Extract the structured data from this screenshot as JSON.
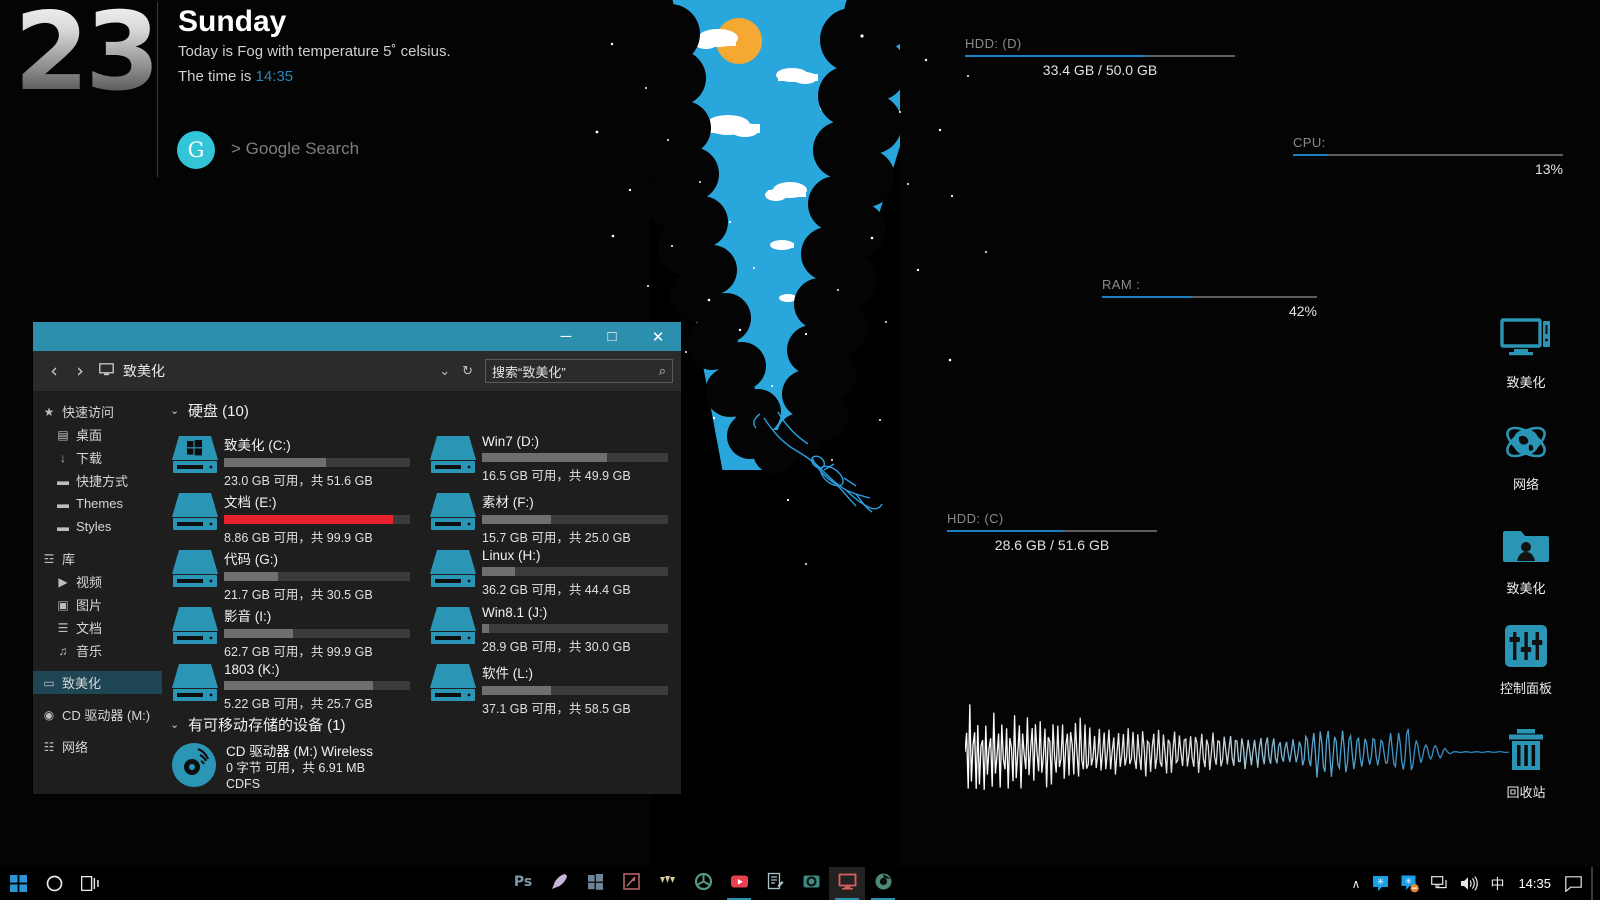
{
  "date_widget": {
    "day_number": "23",
    "weekday": "Sunday",
    "weather_line": "Today is Fog with temperature 5˚ celsius.",
    "time_prefix": "The time is ",
    "time_value": "14:35",
    "google_badge": "G",
    "google_label": "> Google Search",
    "accent_time": "#2e82b5",
    "google_circle": "#32c5d8"
  },
  "monitors": [
    {
      "name": "hdd-d",
      "label": "HDD: (D)",
      "value": "33.4 GB / 50.0 GB",
      "percent": 67
    },
    {
      "name": "cpu",
      "label": "CPU:",
      "value": "13%",
      "percent": 13
    },
    {
      "name": "ram",
      "label": "RAM :",
      "value": "42%",
      "percent": 42
    },
    {
      "name": "hdd-c",
      "label": "HDD: (C)",
      "value": "28.6 GB / 51.6 GB",
      "percent": 55
    }
  ],
  "visualizer": {
    "label": "audio-spectrum",
    "color_start": "#ffffff",
    "color_end": "#1f7fb8"
  },
  "desktop_icons": [
    {
      "name": "this-pc",
      "label": "致美化",
      "icon": "monitor-icon"
    },
    {
      "name": "network",
      "label": "网络",
      "icon": "globe-network-icon"
    },
    {
      "name": "user-folder",
      "label": "致美化",
      "icon": "user-folder-icon"
    },
    {
      "name": "control-panel",
      "label": "控制面板",
      "icon": "sliders-icon"
    },
    {
      "name": "recycle-bin",
      "label": "回收站",
      "icon": "trash-icon"
    }
  ],
  "explorer": {
    "title_bar": {
      "minimize": "─",
      "maximize": "□",
      "close": "✕"
    },
    "nav": {
      "back": "‹",
      "forward": "›",
      "crumb_icon": "computer-icon",
      "crumb_text": "致美化",
      "chevron": "⌄",
      "refresh": "↻",
      "search_placeholder": "搜索“致美化”",
      "search_value": "搜索“致美化”",
      "search_icon": "⌕"
    },
    "sidebar": [
      {
        "label": "快速访问",
        "icon": "pin-star-icon",
        "level": 0,
        "selected": false
      },
      {
        "label": "桌面",
        "icon": "folder-desktop-icon",
        "level": 1,
        "selected": false
      },
      {
        "label": "下载",
        "icon": "download-icon",
        "level": 1,
        "selected": false
      },
      {
        "label": "快捷方式",
        "icon": "folder-icon",
        "level": 1,
        "selected": false
      },
      {
        "label": "Themes",
        "icon": "folder-icon",
        "level": 1,
        "selected": false
      },
      {
        "label": "Styles",
        "icon": "folder-icon",
        "level": 1,
        "selected": false
      },
      {
        "label": "库",
        "icon": "library-icon",
        "level": 0,
        "selected": false
      },
      {
        "label": "视频",
        "icon": "video-icon",
        "level": 1,
        "selected": false
      },
      {
        "label": "图片",
        "icon": "picture-icon",
        "level": 1,
        "selected": false
      },
      {
        "label": "文档",
        "icon": "document-icon",
        "level": 1,
        "selected": false
      },
      {
        "label": "音乐",
        "icon": "music-icon",
        "level": 1,
        "selected": false
      },
      {
        "label": "致美化",
        "icon": "monitor-icon",
        "level": 0,
        "selected": true
      },
      {
        "label": "CD 驱动器 (M:)",
        "icon": "disc-icon",
        "level": 0,
        "selected": false
      },
      {
        "label": "网络",
        "icon": "network-icon",
        "level": 0,
        "selected": false
      }
    ],
    "groups": [
      {
        "label": "硬盘 (10)",
        "chevron": "⌄"
      },
      {
        "label": "有可移动存储的设备 (1)",
        "chevron": "⌄"
      }
    ],
    "drives": [
      {
        "name": "致美化 (C:)",
        "size": "23.0 GB 可用，共 51.6 GB",
        "used_pct": 55,
        "bar": "normal",
        "system": true
      },
      {
        "name": "Win7 (D:)",
        "size": "16.5 GB 可用，共 49.9 GB",
        "used_pct": 67,
        "bar": "normal",
        "system": false
      },
      {
        "name": "文档 (E:)",
        "size": "8.86 GB 可用，共 99.9 GB",
        "used_pct": 91,
        "bar": "red",
        "system": false
      },
      {
        "name": "素材 (F:)",
        "size": "15.7 GB 可用，共 25.0 GB",
        "used_pct": 37,
        "bar": "normal",
        "system": false
      },
      {
        "name": "代码 (G:)",
        "size": "21.7 GB 可用，共 30.5 GB",
        "used_pct": 29,
        "bar": "normal",
        "system": false
      },
      {
        "name": "Linux (H:)",
        "size": "36.2 GB 可用，共 44.4 GB",
        "used_pct": 18,
        "bar": "normal",
        "system": false
      },
      {
        "name": "影音 (I:)",
        "size": "62.7 GB 可用，共 99.9 GB",
        "used_pct": 37,
        "bar": "normal",
        "system": false
      },
      {
        "name": "Win8.1 (J:)",
        "size": "28.9 GB 可用，共 30.0 GB",
        "used_pct": 4,
        "bar": "normal",
        "system": false
      },
      {
        "name": "1803 (K:)",
        "size": "5.22 GB 可用，共 25.7 GB",
        "used_pct": 80,
        "bar": "normal",
        "system": false
      },
      {
        "name": "软件 (L:)",
        "size": "37.1 GB 可用，共 58.5 GB",
        "used_pct": 37,
        "bar": "normal",
        "system": false
      }
    ],
    "removable": {
      "name": "CD 驱动器 (M:) Wireless",
      "size": "0 字节 可用，共 6.91 MB",
      "fs": "CDFS"
    }
  },
  "taskbar": {
    "left": [
      {
        "name": "start-button",
        "icon": "windows-logo-icon"
      },
      {
        "name": "cortana-button",
        "icon": "circle-icon"
      },
      {
        "name": "task-view-button",
        "icon": "task-view-icon"
      }
    ],
    "apps": [
      {
        "name": "photoshop",
        "icon": "ps-icon",
        "label": "Ps",
        "active": false,
        "running": false
      },
      {
        "name": "rocket-dock",
        "icon": "rocket-icon",
        "label": "",
        "active": false,
        "running": false
      },
      {
        "name": "store",
        "icon": "windows-store-icon",
        "label": "",
        "active": false,
        "running": false
      },
      {
        "name": "snipaste",
        "icon": "snip-icon",
        "label": "",
        "active": false,
        "running": false
      },
      {
        "name": "trident",
        "icon": "trident-icon",
        "label": "",
        "active": false,
        "running": false
      },
      {
        "name": "shutter",
        "icon": "aperture-icon",
        "label": "",
        "active": false,
        "running": false
      },
      {
        "name": "youtube",
        "icon": "play-icon",
        "label": "",
        "active": false,
        "running": true
      },
      {
        "name": "notepad",
        "icon": "notes-icon",
        "label": "",
        "active": false,
        "running": false
      },
      {
        "name": "camera",
        "icon": "camera-icon",
        "label": "",
        "active": false,
        "running": false
      },
      {
        "name": "file-explorer",
        "icon": "monitor-icon",
        "label": "",
        "active": true,
        "running": true
      },
      {
        "name": "chrome",
        "icon": "chrome-icon",
        "label": "",
        "active": false,
        "running": true
      }
    ],
    "tray": [
      {
        "name": "show-hidden-icons",
        "icon": "chevron-up-icon",
        "glyph": "∧"
      },
      {
        "name": "qq-icon",
        "icon": "star-badge-icon",
        "glyph": ""
      },
      {
        "name": "qq-secondary-icon",
        "icon": "star-badge-alt-icon",
        "glyph": ""
      },
      {
        "name": "network-icon",
        "icon": "network-icon",
        "glyph": ""
      },
      {
        "name": "volume-icon",
        "icon": "speaker-icon",
        "glyph": ""
      },
      {
        "name": "ime-indicator",
        "icon": "ime-icon",
        "glyph": "中"
      }
    ],
    "clock": "14:35",
    "action_center": "notification-icon",
    "show_desktop": "show-desktop-bar"
  },
  "colors": {
    "accent_teal": "#2b8fad",
    "drive_teal": "#2b95b5",
    "bar_blue": "#1c7fc0",
    "bar_red": "#e8222c",
    "window_bg": "#1e1e1e"
  }
}
